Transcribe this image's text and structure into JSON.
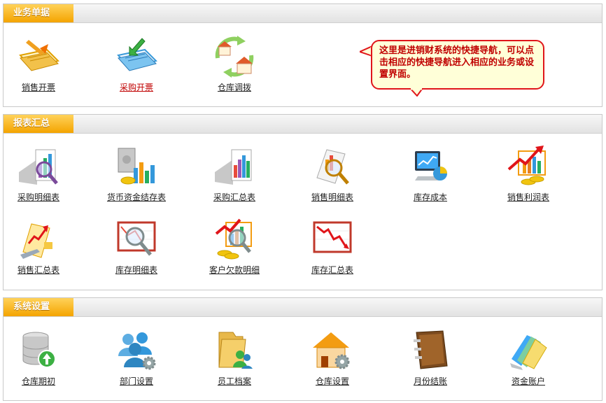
{
  "sections": [
    {
      "title": "业务单据",
      "items": [
        {
          "label": "销售开票",
          "icon": "sales-invoice-icon"
        },
        {
          "label": "采购开票",
          "icon": "purchase-invoice-icon",
          "active": true
        },
        {
          "label": "仓库调拨",
          "icon": "warehouse-transfer-icon"
        }
      ]
    },
    {
      "title": "报表汇总",
      "items": [
        {
          "label": "采购明细表",
          "icon": "purchase-detail-chart-icon"
        },
        {
          "label": "货币资金结存表",
          "icon": "cash-balance-icon"
        },
        {
          "label": "采购汇总表",
          "icon": "purchase-summary-chart-icon"
        },
        {
          "label": "销售明细表",
          "icon": "sales-detail-chart-icon"
        },
        {
          "label": "库存成本",
          "icon": "inventory-cost-icon"
        },
        {
          "label": "销售利润表",
          "icon": "sales-profit-icon"
        },
        {
          "label": "销售汇总表",
          "icon": "sales-summary-icon"
        },
        {
          "label": "库存明细表",
          "icon": "inventory-detail-icon"
        },
        {
          "label": "客户欠款明细",
          "icon": "customer-debt-icon"
        },
        {
          "label": "库存汇总表",
          "icon": "inventory-summary-icon"
        }
      ]
    },
    {
      "title": "系统设置",
      "items": [
        {
          "label": "仓库期初",
          "icon": "warehouse-initial-icon"
        },
        {
          "label": "部门设置",
          "icon": "department-settings-icon"
        },
        {
          "label": "员工档案",
          "icon": "employee-records-icon"
        },
        {
          "label": "仓库设置",
          "icon": "warehouse-settings-icon"
        },
        {
          "label": "月份结账",
          "icon": "month-closing-icon"
        },
        {
          "label": "资金账户",
          "icon": "fund-account-icon"
        }
      ]
    }
  ],
  "tip": "这里是进销财系统的快捷导航，可以点击相应的快捷导航进入相应的业务或设置界面。",
  "colors": {
    "title_bg": "#f4a400",
    "tip_border": "#e0151a",
    "tip_text": "#c00000",
    "tip_bg": "#ffffd8"
  }
}
